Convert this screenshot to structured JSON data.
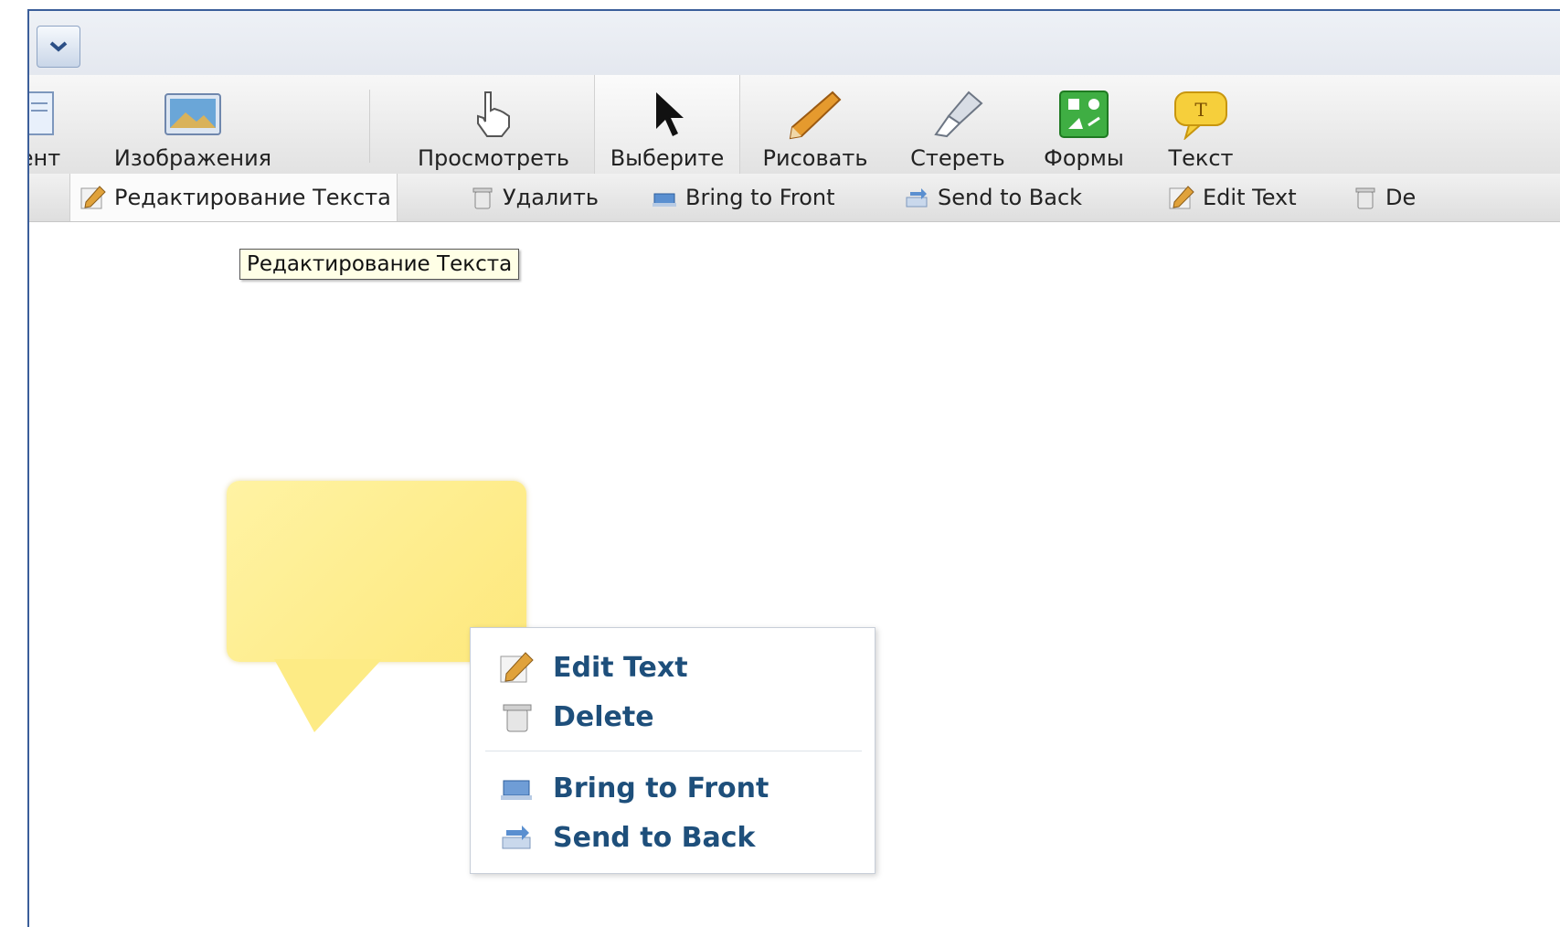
{
  "ribbon": {
    "items": [
      {
        "label": "ент"
      },
      {
        "label": "Изображения"
      },
      {
        "label": "Просмотреть"
      },
      {
        "label": "Выберите"
      },
      {
        "label": "Рисовать"
      },
      {
        "label": "Стереть"
      },
      {
        "label": "Формы"
      },
      {
        "label": "Текст"
      }
    ],
    "selected": "Выберите"
  },
  "subbar": {
    "items": [
      {
        "label": "Редактирование Текста"
      },
      {
        "label": "Удалить"
      },
      {
        "label": "Bring to Front"
      },
      {
        "label": "Send to Back"
      },
      {
        "label": "Edit Text"
      },
      {
        "label": "De"
      }
    ]
  },
  "tooltip": {
    "text": "Редактирование Текста"
  },
  "context_menu": {
    "items": [
      {
        "label": "Edit Text"
      },
      {
        "label": "Delete"
      },
      {
        "label": "Bring to Front"
      },
      {
        "label": "Send to Back"
      }
    ]
  },
  "colors": {
    "frame_border": "#3b5e9a",
    "menu_text": "#1e4f7b",
    "callout_fill": "#fde87c",
    "tooltip_bg": "#ffffe6"
  }
}
